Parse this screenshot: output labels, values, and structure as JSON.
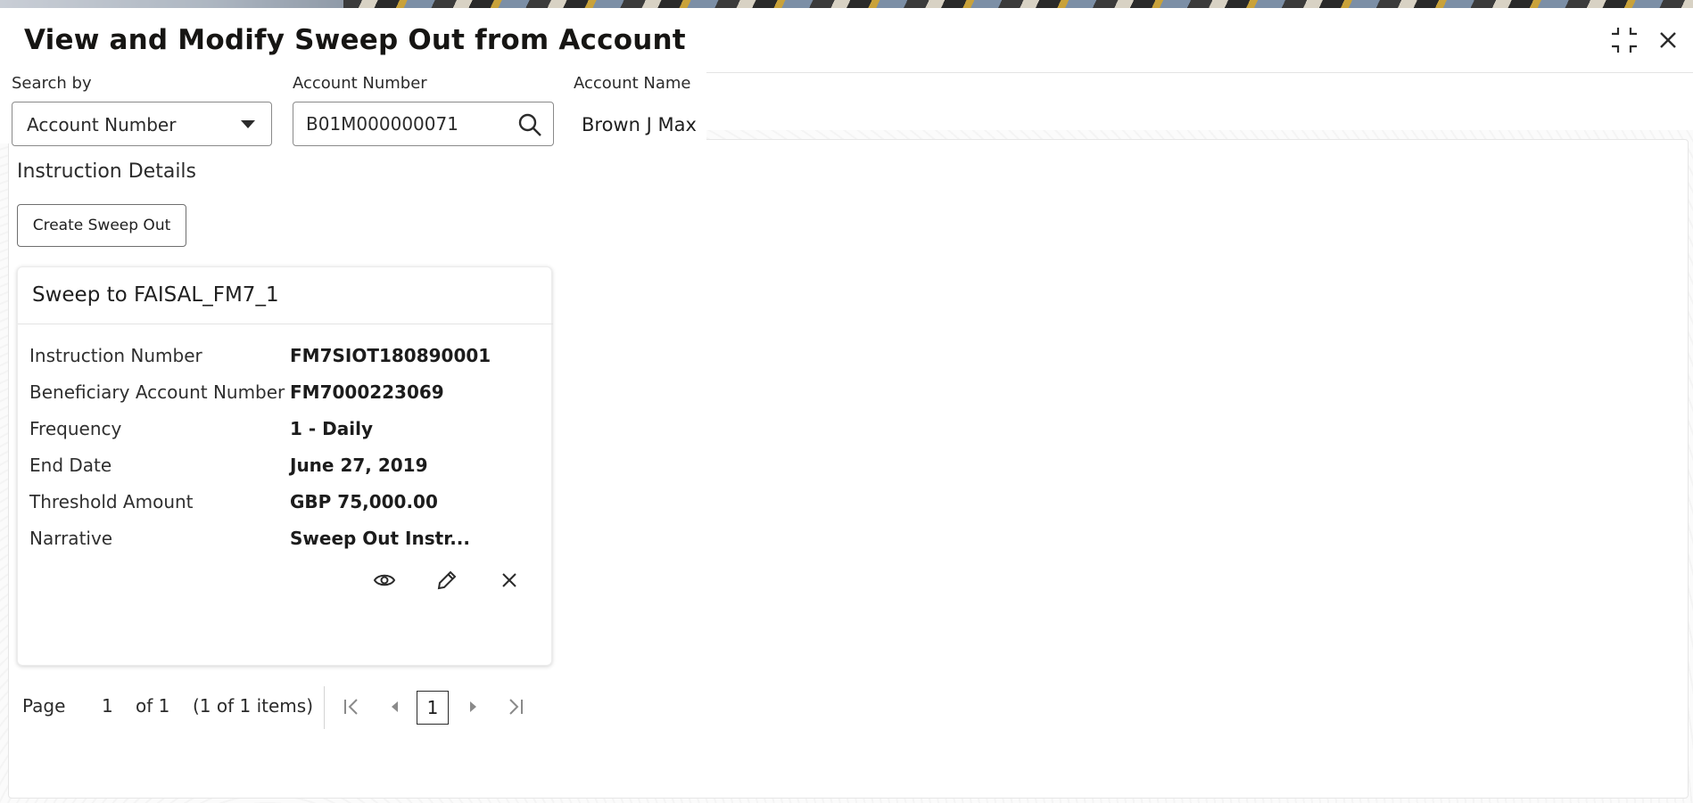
{
  "window": {
    "title": "View and Modify Sweep Out from Account",
    "minimize_icon": "collapse-icon",
    "close_icon": "close-icon"
  },
  "search": {
    "search_by_label": "Search by",
    "search_by_value": "Account Number",
    "account_number_label": "Account Number",
    "account_number_value": "B01M000000071",
    "account_name_label": "Account Name",
    "account_name_value": "Brown J Max"
  },
  "instructions": {
    "section_title": "Instruction Details",
    "create_button_label": "Create Sweep Out",
    "cards": [
      {
        "title": "Sweep to FAISAL_FM7_1",
        "rows": [
          {
            "label": "Instruction Number",
            "value": "FM7SIOT180890001"
          },
          {
            "label": "Beneficiary Account Number",
            "value": "FM7000223069"
          },
          {
            "label": "Frequency",
            "value": "1 - Daily"
          },
          {
            "label": "End Date",
            "value": "June 27, 2019"
          },
          {
            "label": "Threshold Amount",
            "value": "GBP 75,000.00"
          },
          {
            "label": "Narrative",
            "value": "Sweep Out Instr..."
          }
        ],
        "actions": [
          "view-icon",
          "edit-icon",
          "delete-icon"
        ]
      }
    ]
  },
  "pagination": {
    "page_label": "Page",
    "page_number": "1",
    "of_label": "of 1",
    "items_label": "(1 of 1 items)",
    "current_page_button": "1"
  }
}
